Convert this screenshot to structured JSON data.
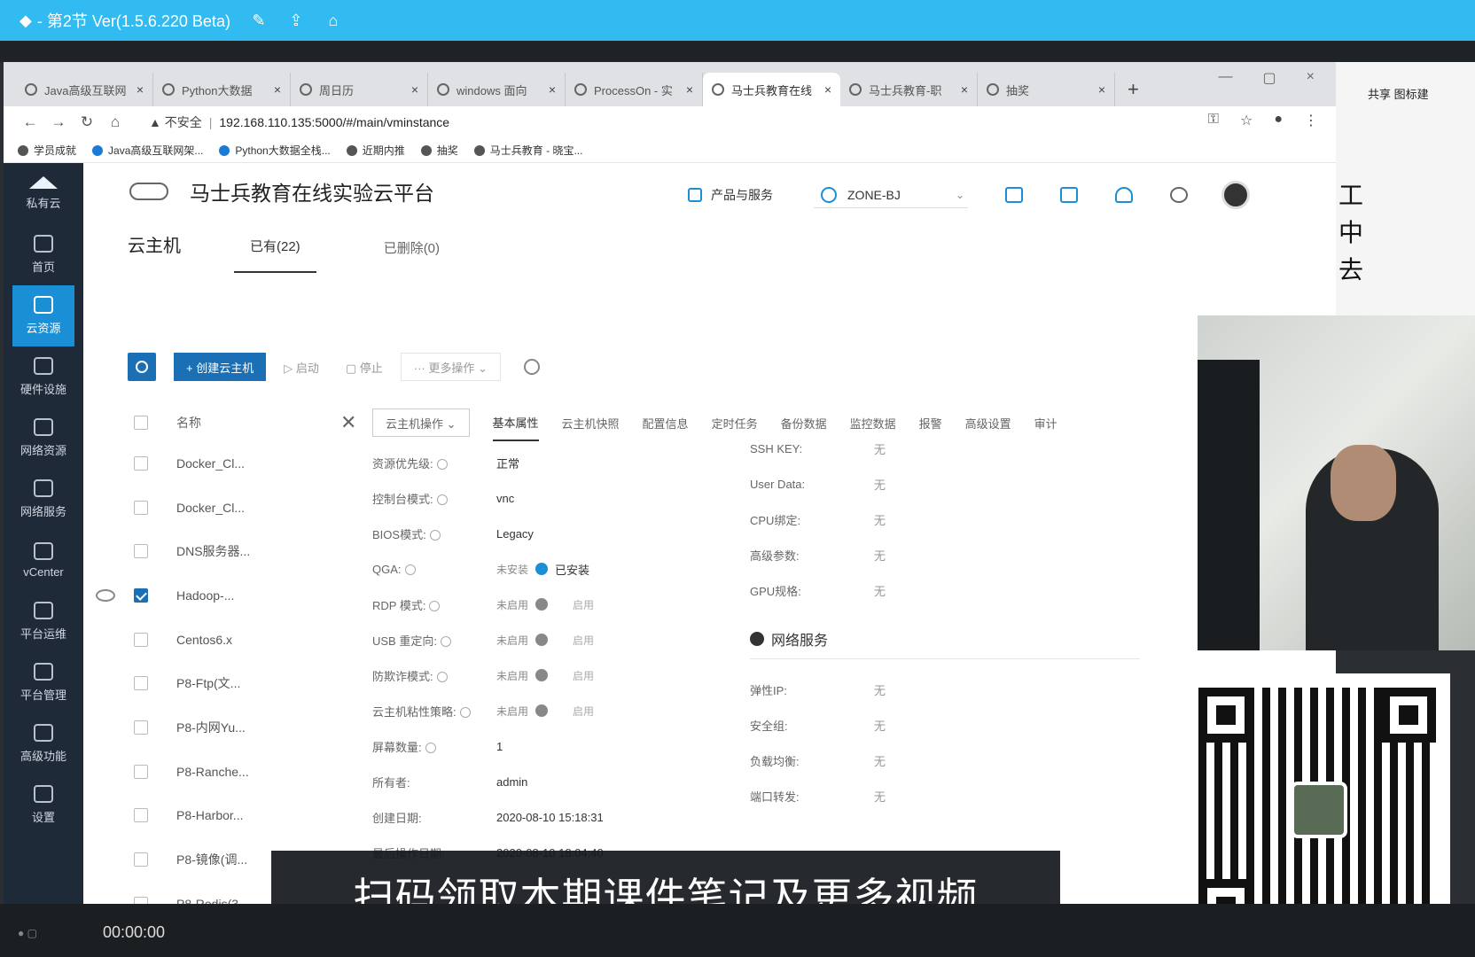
{
  "app": {
    "title": "- 第2节 Ver(1.5.6.220 Beta)"
  },
  "browser": {
    "tabs": [
      {
        "label": "Java高级互联网",
        "active": false
      },
      {
        "label": "Python大数据",
        "active": false
      },
      {
        "label": "周日历",
        "active": false
      },
      {
        "label": "windows 面向",
        "active": false
      },
      {
        "label": "ProcessOn - 实",
        "active": false
      },
      {
        "label": "马士兵教育在线",
        "active": true
      },
      {
        "label": "马士兵教育-职",
        "active": false
      },
      {
        "label": "抽奖",
        "active": false
      }
    ],
    "insecure": "不安全",
    "url": "192.168.110.135:5000/#/main/vminstance",
    "bookmarks": [
      "学员成就",
      "Java高级互联网架...",
      "Python大数据全栈...",
      "近期内推",
      "抽奖",
      "马士兵教育 - 晓宝..."
    ]
  },
  "sidebar": {
    "items": [
      {
        "label": "私有云",
        "icon": "cloud-stack-icon"
      },
      {
        "label": "首页",
        "icon": "home-icon"
      },
      {
        "label": "云资源",
        "icon": "cloud-resource-icon",
        "active": true
      },
      {
        "label": "硬件设施",
        "icon": "hardware-icon"
      },
      {
        "label": "网络资源",
        "icon": "network-icon"
      },
      {
        "label": "网络服务",
        "icon": "network-service-icon"
      },
      {
        "label": "vCenter",
        "icon": "vcenter-icon"
      },
      {
        "label": "平台运维",
        "icon": "ops-icon"
      },
      {
        "label": "平台管理",
        "icon": "admin-icon"
      },
      {
        "label": "高级功能",
        "icon": "advanced-icon"
      },
      {
        "label": "设置",
        "icon": "settings-icon"
      }
    ]
  },
  "header": {
    "title": "马士兵教育在线实验云平台",
    "products": "产品与服务",
    "zone": "ZONE-BJ"
  },
  "page": {
    "title": "云主机",
    "tab_existing": "已有(22)",
    "tab_deleted": "已删除(0)"
  },
  "toolbar": {
    "create": "+ 创建云主机",
    "start": "▷ 启动",
    "stop": "▢ 停止",
    "more": "··· 更多操作 ⌄"
  },
  "list": {
    "header": "名称",
    "rows": [
      {
        "name": "Docker_Cl...",
        "checked": false
      },
      {
        "name": "Docker_Cl...",
        "checked": false
      },
      {
        "name": "DNS服务器...",
        "checked": false
      },
      {
        "name": "Hadoop-...",
        "checked": true
      },
      {
        "name": "Centos6.x",
        "checked": false
      },
      {
        "name": "P8-Ftp(文...",
        "checked": false
      },
      {
        "name": "P8-内网Yu...",
        "checked": false
      },
      {
        "name": "P8-Ranche...",
        "checked": false
      },
      {
        "name": "P8-Harbor...",
        "checked": false
      },
      {
        "name": "P8-镜像(调...",
        "checked": false
      },
      {
        "name": "P8-Redis(3...",
        "checked": false
      }
    ]
  },
  "detail": {
    "op_button": "云主机操作 ⌄",
    "tabs": [
      "基本属性",
      "云主机快照",
      "配置信息",
      "定时任务",
      "备份数据",
      "监控数据",
      "报警",
      "高级设置",
      "审计"
    ],
    "left_props": [
      {
        "key": "资源优先级:",
        "value": "正常"
      },
      {
        "key": "控制台模式:",
        "value": "vnc"
      },
      {
        "key": "BIOS模式:",
        "value": "Legacy"
      },
      {
        "key": "QGA:",
        "status": "未安装",
        "value": "已安装"
      },
      {
        "key": "RDP 模式:",
        "status": "未启用",
        "value": "启用"
      },
      {
        "key": "USB 重定向:",
        "status": "未启用",
        "value": "启用"
      },
      {
        "key": "防欺诈模式:",
        "status": "未启用",
        "value": "启用"
      },
      {
        "key": "云主机粘性策略:",
        "status": "未启用",
        "value": "启用"
      },
      {
        "key": "屏幕数量:",
        "value": "1"
      },
      {
        "key": "所有者:",
        "value": "admin"
      },
      {
        "key": "创建日期:",
        "value": "2020-08-10 15:18:31"
      },
      {
        "key": "最后操作日期:",
        "value": "2020-08-10 18:04:40"
      }
    ],
    "right_props": [
      {
        "key": "SSH KEY:",
        "value": "无"
      },
      {
        "key": "User Data:",
        "value": "无"
      },
      {
        "key": "CPU绑定:",
        "value": "无"
      },
      {
        "key": "高级参数:",
        "value": "无"
      },
      {
        "key": "GPU规格:",
        "value": "无"
      }
    ],
    "network_section": "网络服务",
    "network_props": [
      {
        "key": "弹性IP:",
        "value": "无"
      },
      {
        "key": "安全组:",
        "value": "无"
      },
      {
        "key": "负载均衡:",
        "value": "无"
      },
      {
        "key": "端口转发:",
        "value": "无"
      }
    ]
  },
  "overlay": {
    "share": "共享  图标建",
    "side_chars": [
      "工",
      "中",
      "去"
    ],
    "caption": "扫码领取本期课件笔记及更多视频",
    "time": "00:00:00"
  }
}
